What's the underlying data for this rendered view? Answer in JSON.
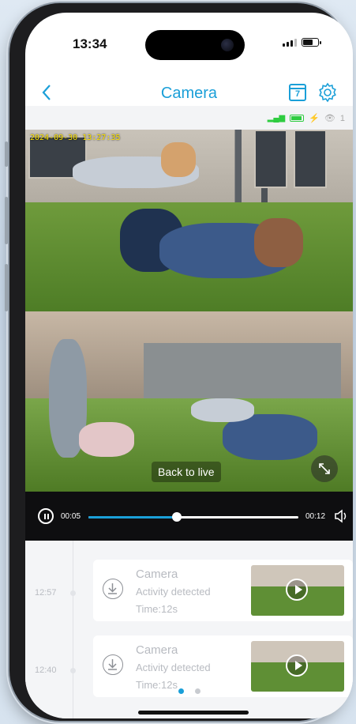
{
  "status_bar": {
    "time": "13:34"
  },
  "nav": {
    "back_icon": "chevron-left-icon",
    "title": "Camera",
    "calendar_day": "7",
    "settings_icon": "gear-icon"
  },
  "info_bar": {
    "viewer_count": "1"
  },
  "video": {
    "timestamp": "2024-09-30 13:27:35",
    "back_to_live": "Back to live"
  },
  "player": {
    "elapsed": "00:05",
    "duration": "00:12",
    "progress": 0.42
  },
  "events": [
    {
      "time": "12:57",
      "camera": "Camera",
      "event": "Activity detected",
      "duration": "Time:12s"
    },
    {
      "time": "12:40",
      "camera": "Camera",
      "event": "Activity detected",
      "duration": "Time:12s"
    }
  ],
  "pagination": {
    "current": 1,
    "total": 2
  },
  "colors": {
    "accent": "#1a9fd8",
    "player_bg": "#0e0e10",
    "muted_text": "#b8bbc1"
  }
}
